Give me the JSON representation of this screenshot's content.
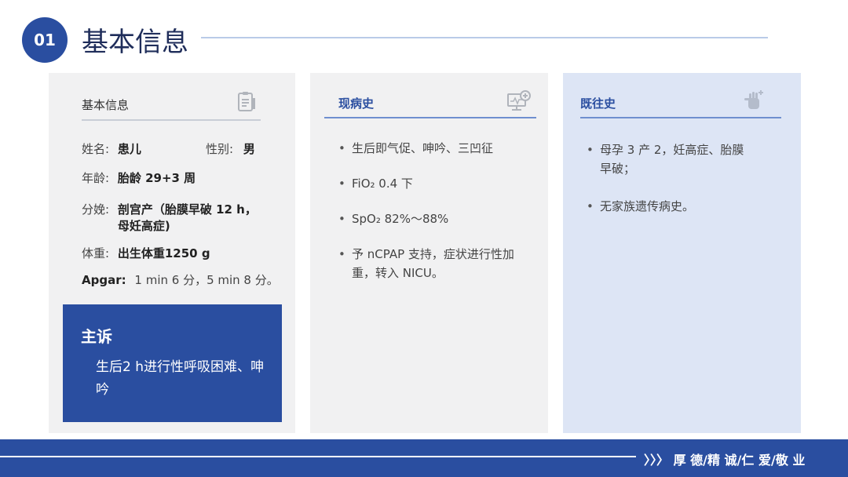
{
  "header": {
    "number": "01",
    "title": "基本信息"
  },
  "basic_card": {
    "heading": "基本信息",
    "icon": "clipboard-icon",
    "rows": {
      "name_label": "姓名:",
      "name_value": "患儿",
      "sex_label": "性别:",
      "sex_value": "男",
      "age_label": "年龄:",
      "age_value": "胎龄 29+3 周",
      "delivery_label": "分娩:",
      "delivery_value_1": "剖宫产（胎膜早破 12 h，",
      "delivery_value_2": "母妊高症)",
      "weight_label": "体重:",
      "weight_value": "出生体重1250 g",
      "apgar_label": "Apgar:",
      "apgar_value": "1 min 6 分，5 min 8 分。"
    },
    "complaint": {
      "title": "主诉",
      "text": "生后2 h进行性呼吸困难、呻吟"
    }
  },
  "present_card": {
    "heading": "现病史",
    "icon": "monitor-plus-icon",
    "items": [
      "生后即气促、呻吟、三凹征",
      "FiO₂ 0.4 下",
      "SpO₂ 82%～88%",
      "予 nCPAP 支持，症状进行性加重，转入 NICU。"
    ]
  },
  "past_card": {
    "heading": "既往史",
    "icon": "hand-medical-icon",
    "items": [
      "母孕 3 产 2，妊高症、胎膜早破；",
      "无家族遗传病史。"
    ]
  },
  "footer": {
    "motto": "〉〉〉 厚 德/精 诚/仁 爱/敬 业"
  },
  "colors": {
    "primary": "#2a4ea0",
    "card_gray": "#f1f1f2",
    "card_blue": "#dde5f5"
  }
}
